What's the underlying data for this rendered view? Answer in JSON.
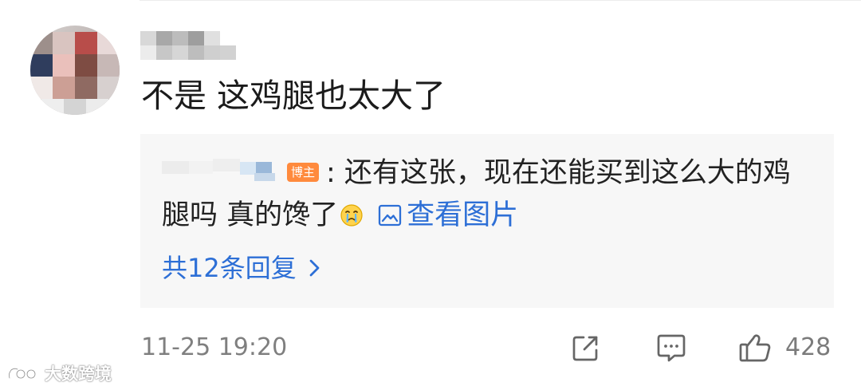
{
  "comment": {
    "text": "不是 这鸡腿也太大了",
    "timestamp": "11-25 19:20"
  },
  "reply": {
    "badge": "博主",
    "line1": ": 还有这张，现在还能买到这么大的鸡",
    "line2": "腿吗 真的馋了",
    "emoji": "cry-face-icon",
    "image_link_label": "查看图片",
    "more_replies_label": "共12条回复"
  },
  "actions": {
    "share_icon": "share-icon",
    "comment_icon": "comment-icon",
    "like_icon": "thumbs-up-icon",
    "like_count": "428"
  },
  "watermark": {
    "text": "大数跨境"
  },
  "colors": {
    "link": "#2d6fd6",
    "badge": "#ff8a3d",
    "reply_background": "#f7f7f7",
    "muted_text": "#7f7f7f"
  }
}
